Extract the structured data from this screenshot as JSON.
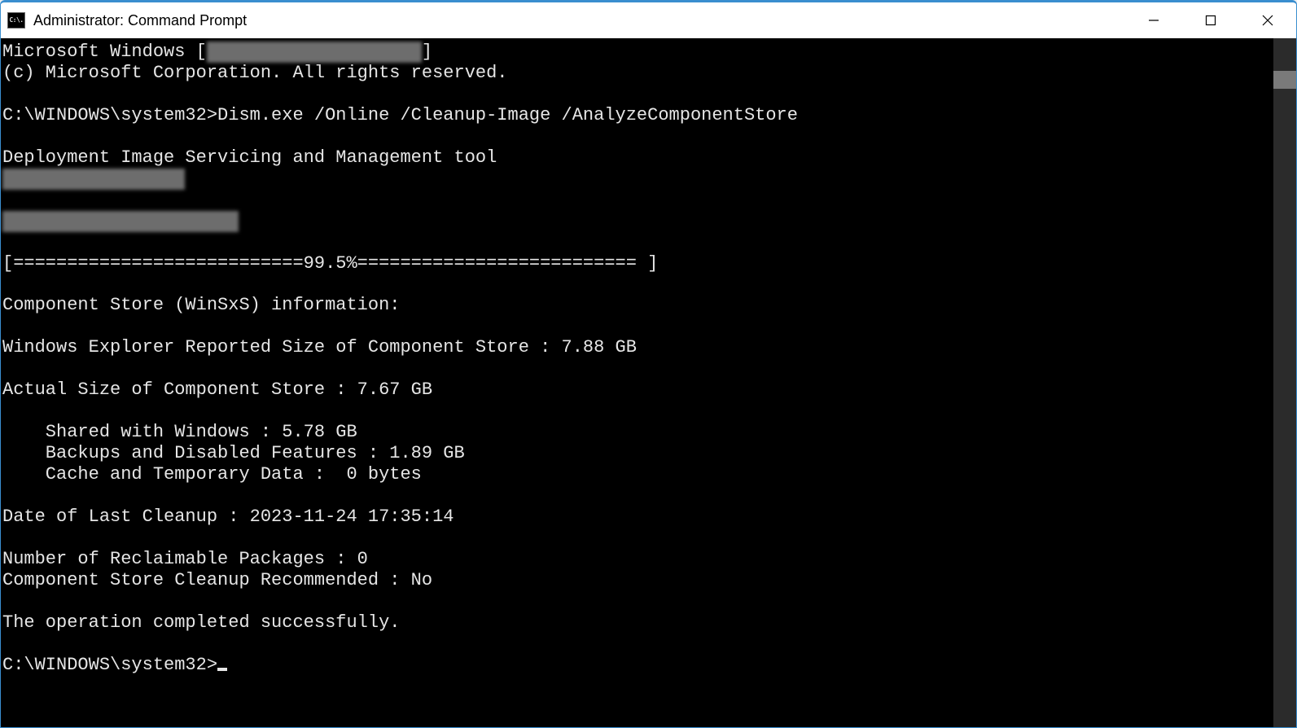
{
  "window": {
    "title": "Administrator: Command Prompt",
    "app_icon_text": "C:\\."
  },
  "terminal": {
    "header_prefix": "Microsoft Windows [",
    "header_suffix": "]",
    "copyright": "(c) Microsoft Corporation. All rights reserved.",
    "prompt1": "C:\\WINDOWS\\system32>",
    "command1": "Dism.exe /Online /Cleanup-Image /AnalyzeComponentStore",
    "dism_title": "Deployment Image Servicing and Management tool",
    "progress": "[===========================99.5%========================== ]",
    "info_header": "Component Store (WinSxS) information:",
    "reported_size": "Windows Explorer Reported Size of Component Store : 7.88 GB",
    "actual_size": "Actual Size of Component Store : 7.67 GB",
    "shared": "    Shared with Windows : 5.78 GB",
    "backups": "    Backups and Disabled Features : 1.89 GB",
    "cache": "    Cache and Temporary Data :  0 bytes",
    "last_cleanup": "Date of Last Cleanup : 2023-11-24 17:35:14",
    "reclaimable": "Number of Reclaimable Packages : 0",
    "cleanup_rec": "Component Store Cleanup Recommended : No",
    "success": "The operation completed successfully.",
    "prompt2": "C:\\WINDOWS\\system32>"
  }
}
